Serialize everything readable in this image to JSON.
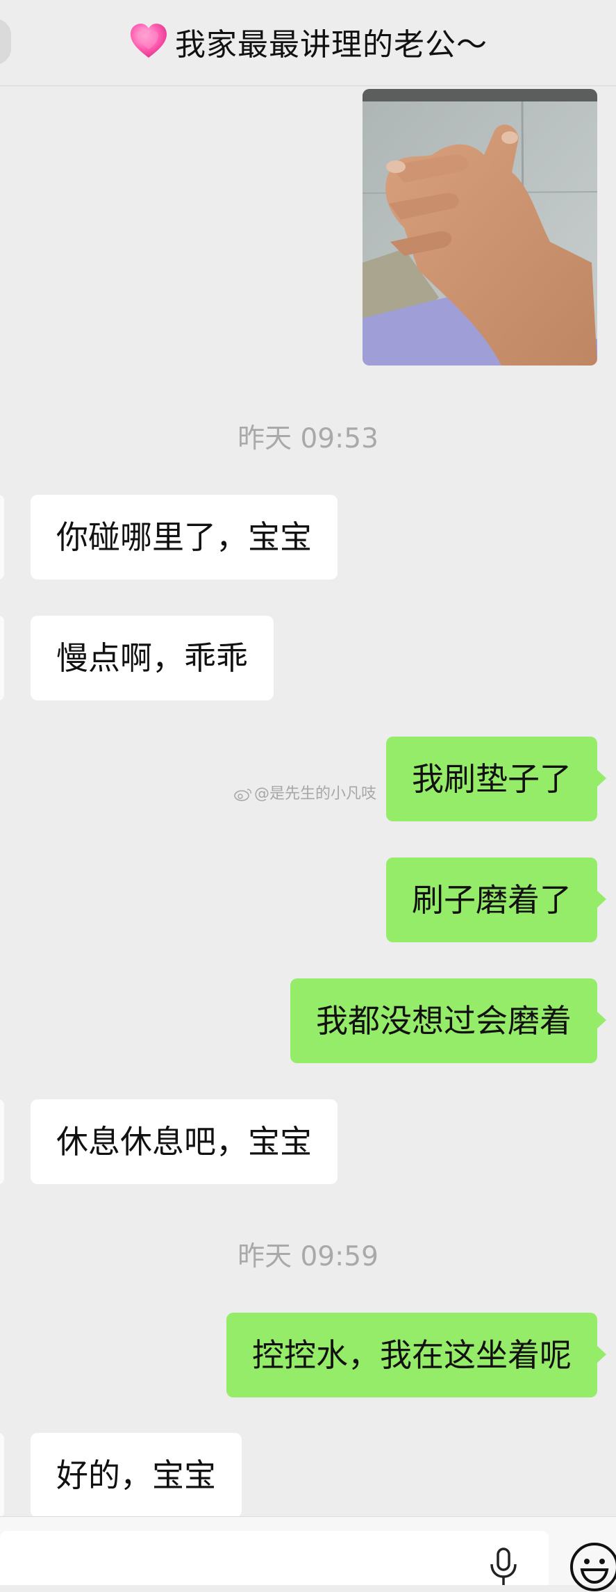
{
  "header": {
    "title": "我家最最讲理的老公～",
    "heart_icon": "pink-heart-emoji"
  },
  "messages": [
    {
      "type": "image",
      "side": "right"
    },
    {
      "type": "time",
      "text": "昨天 09:53"
    },
    {
      "type": "text",
      "side": "left",
      "text": "你碰哪里了，宝宝"
    },
    {
      "type": "text",
      "side": "left",
      "text": "慢点啊，乖乖"
    },
    {
      "type": "text",
      "side": "right",
      "text": "我刷垫子了"
    },
    {
      "type": "text",
      "side": "right",
      "text": "刷子磨着了"
    },
    {
      "type": "text",
      "side": "right",
      "text": "我都没想过会磨着"
    },
    {
      "type": "text",
      "side": "left",
      "text": "休息休息吧，宝宝"
    },
    {
      "type": "time",
      "text": "昨天 09:59"
    },
    {
      "type": "text",
      "side": "right",
      "text": "控控水，我在这坐着呢"
    },
    {
      "type": "text",
      "side": "left",
      "text": "好的，宝宝"
    }
  ],
  "watermark": "@是先生的小凡吱",
  "input_bar": {
    "voice_icon": "microphone-icon",
    "emoji_icon": "smiley-icon"
  },
  "colors": {
    "background": "#ededed",
    "sent_bubble": "#95ec69",
    "received_bubble": "#ffffff",
    "timestamp": "#a9a9a9"
  }
}
